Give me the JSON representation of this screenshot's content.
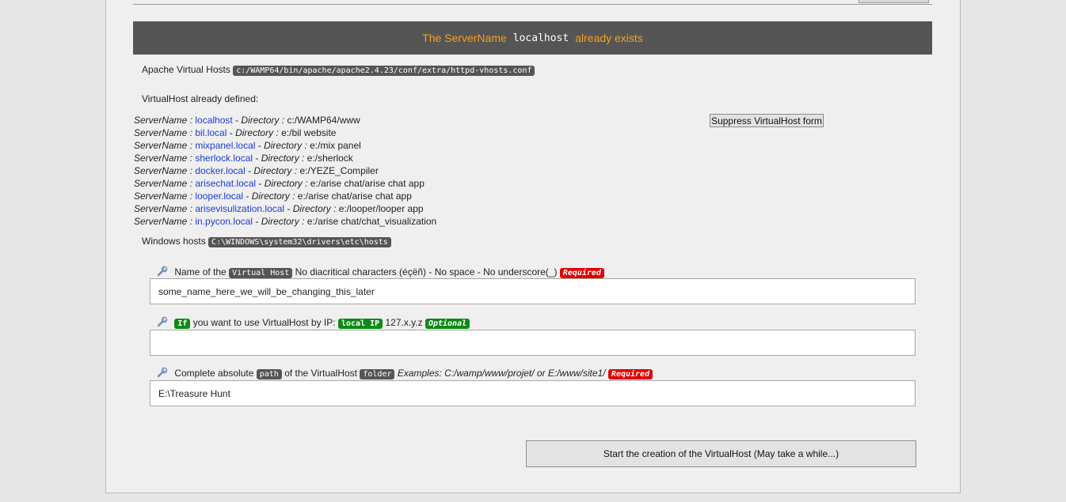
{
  "banner": {
    "prefix": "The ServerName",
    "server": "localhost",
    "suffix": "already exists"
  },
  "apache_vhosts": {
    "label": "Apache Virtual Hosts",
    "path": "c:/WAMP64/bin/apache/apache2.4.23/conf/extra/httpd-vhosts.conf"
  },
  "defined_label": "VirtualHost already defined:",
  "labels": {
    "server_name": "ServerName :",
    "directory": "Directory :"
  },
  "virtual_hosts": [
    {
      "name": "localhost",
      "dir": "c:/WAMP64/www"
    },
    {
      "name": "bil.local",
      "dir": "e:/bil website"
    },
    {
      "name": "mixpanel.local",
      "dir": "e:/mix panel"
    },
    {
      "name": "sherlock.local",
      "dir": "e:/sherlock"
    },
    {
      "name": "docker.local",
      "dir": "e:/YEZE_Compiler"
    },
    {
      "name": "arisechat.local",
      "dir": "e:/arise chat/arise chat app"
    },
    {
      "name": "looper.local",
      "dir": "e:/arise chat/arise chat app"
    },
    {
      "name": "arisevisulization.local",
      "dir": "e:/looper/looper app"
    },
    {
      "name": "in.pycon.local",
      "dir": "e:/arise chat/chat_visualization"
    }
  ],
  "suppress_button": "Suppress VirtualHost form",
  "windows_hosts": {
    "label": "Windows hosts",
    "path": "C:\\WINDOWS\\system32\\drivers\\etc\\hosts"
  },
  "form": {
    "name": {
      "pre": "Name of the",
      "tag": "Virtual Host",
      "post": "No diacritical characters (éçëñ) - No space - No underscore(_)",
      "required": "Required",
      "value": "some_name_here_we_will_be_changing_this_later"
    },
    "ip": {
      "tag_if": "If",
      "pre": "you want to use VirtualHost by IP:",
      "tag_ip": "local IP",
      "post": "127.x.y.z",
      "optional": "Optional",
      "value": ""
    },
    "path": {
      "pre": "Complete absolute",
      "tag_path": "path",
      "mid": "of the VirtualHost",
      "tag_folder": "folder",
      "examples": "Examples: C:/wamp/www/projet/ or E:/www/site1/",
      "required": "Required",
      "value": "E:\\Treasure Hunt"
    }
  },
  "start_button": "Start the creation of the VirtualHost (May take a while...)",
  "colors": {
    "banner_bg": "#555555",
    "banner_text": "#f0a022",
    "link": "#1a3cd8",
    "required": "#e00000",
    "optional": "#0e8a16"
  }
}
